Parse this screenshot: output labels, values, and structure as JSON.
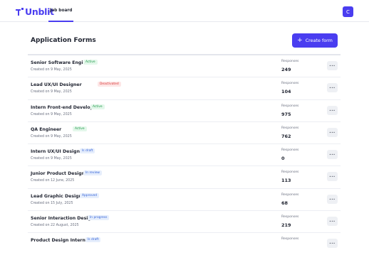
{
  "header": {
    "logo_text": "Unblit",
    "nav_tab": "Job board",
    "avatar_initial": "C"
  },
  "main": {
    "title": "Application Forms",
    "create_label": "Create form",
    "responses_label": "Responses"
  },
  "forms": [
    {
      "title": "Senior Software Engineer",
      "status": "Active",
      "created": "Created on 9 May, 2025",
      "responses": "249"
    },
    {
      "title": "Lead UX/UI Designer",
      "status": "Deactivated",
      "created": "Created on 9 May, 2025",
      "responses": "104"
    },
    {
      "title": "Intern Front-end Developer",
      "status": "Active",
      "created": "Created on 9 May, 2025",
      "responses": "975"
    },
    {
      "title": "QA Engineer",
      "status": "Active",
      "created": "Created on 9 May, 2025",
      "responses": "762"
    },
    {
      "title": "Intern UX/UI Designer",
      "status": "Is draft",
      "created": "Created on 9 May, 2025",
      "responses": "0"
    },
    {
      "title": "Junior Product Designer",
      "status": "In review",
      "created": "Created on 12 June, 2025",
      "responses": "113"
    },
    {
      "title": "Lead Graphic Designer",
      "status": "Approved",
      "created": "Created on 15 July, 2025",
      "responses": "68"
    },
    {
      "title": "Senior Interaction Designer",
      "status": "In progress",
      "created": "Created on 22 August, 2025",
      "responses": "219"
    },
    {
      "title": "Product Design Intern",
      "status": "Is draft",
      "created": "",
      "responses": ""
    }
  ],
  "status_colors": {
    "Active": {
      "bg": "#e3f7ea",
      "fg": "#1f9a4a"
    },
    "Deactivated": {
      "bg": "#fde6e6",
      "fg": "#d93636"
    },
    "Is draft": {
      "bg": "#e6eefc",
      "fg": "#3563d8"
    },
    "In review": {
      "bg": "#e6eefc",
      "fg": "#3563d8"
    },
    "Approved": {
      "bg": "#e6eefc",
      "fg": "#3563d8"
    },
    "In progress": {
      "bg": "#e6eefc",
      "fg": "#3563d8"
    }
  },
  "accent_color": "#4a3df0"
}
